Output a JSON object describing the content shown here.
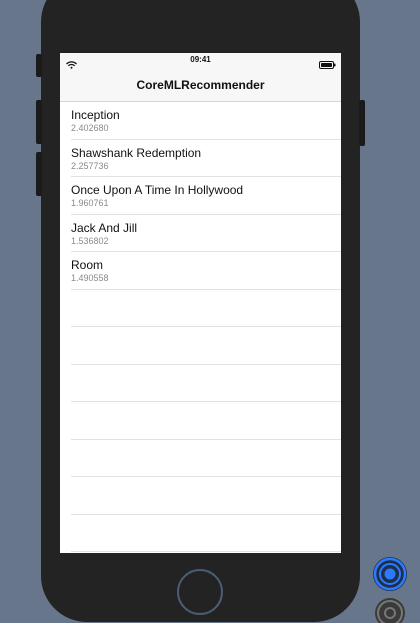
{
  "status_bar": {
    "time": "09:41",
    "wifi_icon": "wifi-icon",
    "battery_icon": "battery-icon"
  },
  "nav": {
    "title": "CoreMLRecommender"
  },
  "rows": [
    {
      "title": "Inception",
      "score": "2.402680"
    },
    {
      "title": "Shawshank Redemption",
      "score": "2.257736"
    },
    {
      "title": "Once Upon A Time In Hollywood",
      "score": "1.960761"
    },
    {
      "title": "Jack And Jill",
      "score": "1.536802"
    },
    {
      "title": "Room",
      "score": "1.490558"
    }
  ],
  "colors": {
    "accent": "#2b7bff",
    "background": "#67768a",
    "device": "#232323"
  }
}
